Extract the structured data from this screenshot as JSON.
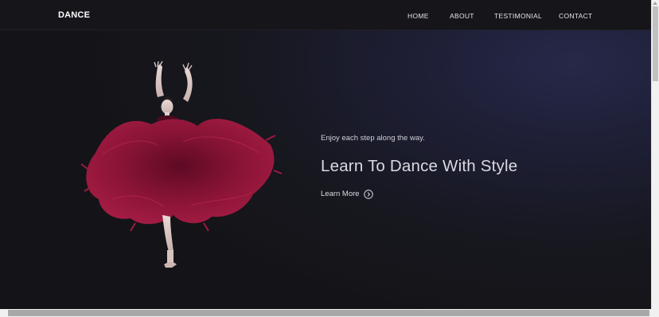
{
  "nav": {
    "brand": "DANCE",
    "links": [
      "HOME",
      "ABOUT",
      "TESTIMONIAL",
      "CONTACT"
    ]
  },
  "hero": {
    "tagline": "Enjoy each step along the way.",
    "headline": "Learn To Dance With Style",
    "cta_label": "Learn More",
    "cta_icon": "arrow-circle-right-icon",
    "image": "ballerina-red-dress-photo"
  },
  "colors": {
    "nav_bg": "#15151a",
    "hero_bg": "#1d1e33",
    "dress": "#8a1436",
    "text": "#d9dae2"
  }
}
